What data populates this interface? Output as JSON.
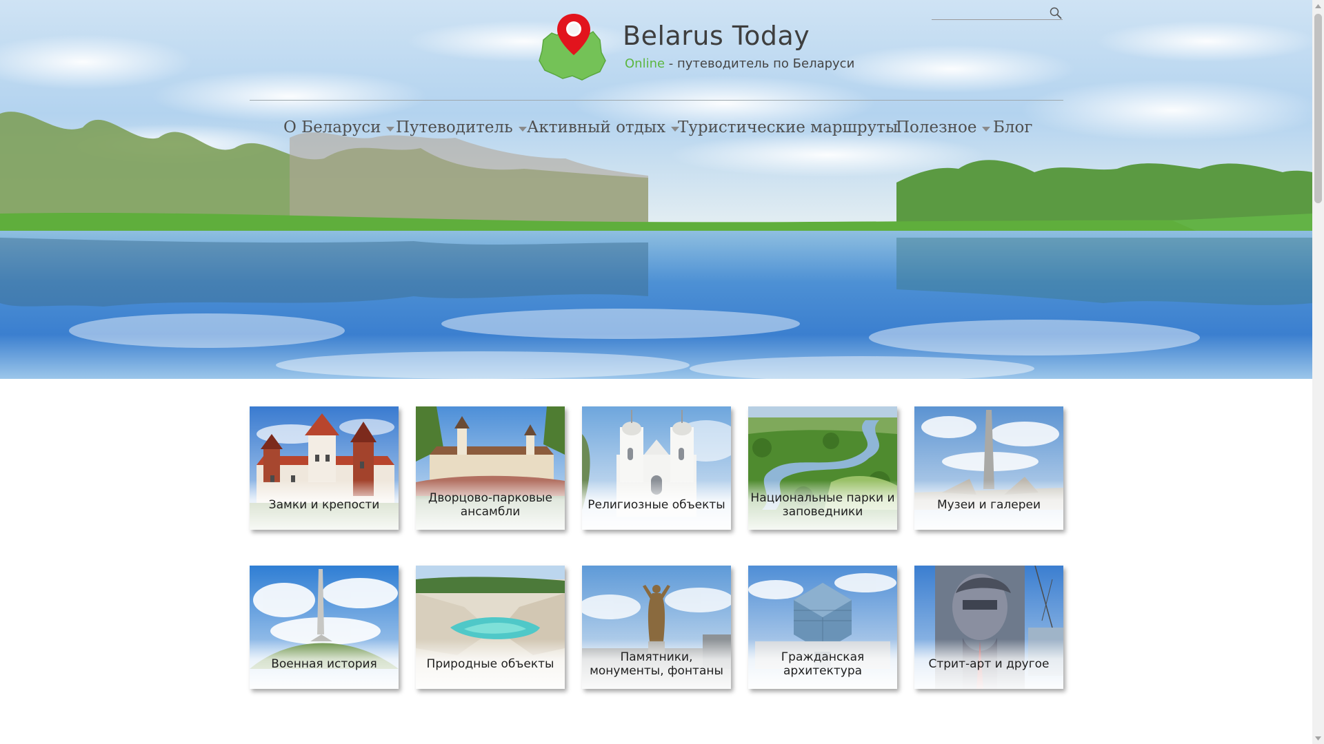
{
  "header": {
    "title": "Belarus Today",
    "subtitle_accent": "Online",
    "subtitle_rest": " - путеводитель по Беларуси",
    "accent_color": "#5cb640"
  },
  "search": {
    "placeholder": "",
    "value": "",
    "icon": "search-icon"
  },
  "nav": {
    "items": [
      {
        "label": "О Беларуси",
        "has_submenu": true
      },
      {
        "label": "Путеводитель",
        "has_submenu": true
      },
      {
        "label": "Активный отдых",
        "has_submenu": true
      },
      {
        "label": "Туристические маршруты",
        "has_submenu": false
      },
      {
        "label": "Полезное",
        "has_submenu": true
      },
      {
        "label": "Блог",
        "has_submenu": false
      }
    ]
  },
  "categories": [
    {
      "label": "Замки и крепости",
      "icon": "castle"
    },
    {
      "label": "Дворцово-парковые ансамбли",
      "icon": "palace"
    },
    {
      "label": "Религиозные объекты",
      "icon": "church"
    },
    {
      "label": "Национальные парки и заповедники",
      "icon": "river-landscape"
    },
    {
      "label": "Музеи и галереи",
      "icon": "memorial-obelisk"
    },
    {
      "label": "Военная история",
      "icon": "mound-memorial"
    },
    {
      "label": "Природные объекты",
      "icon": "quarry-lake"
    },
    {
      "label": "Памятники, монументы, фонтаны",
      "icon": "statue"
    },
    {
      "label": "Гражданская архитектура",
      "icon": "library-building"
    },
    {
      "label": "Стрит-арт и другое",
      "icon": "mural"
    }
  ]
}
